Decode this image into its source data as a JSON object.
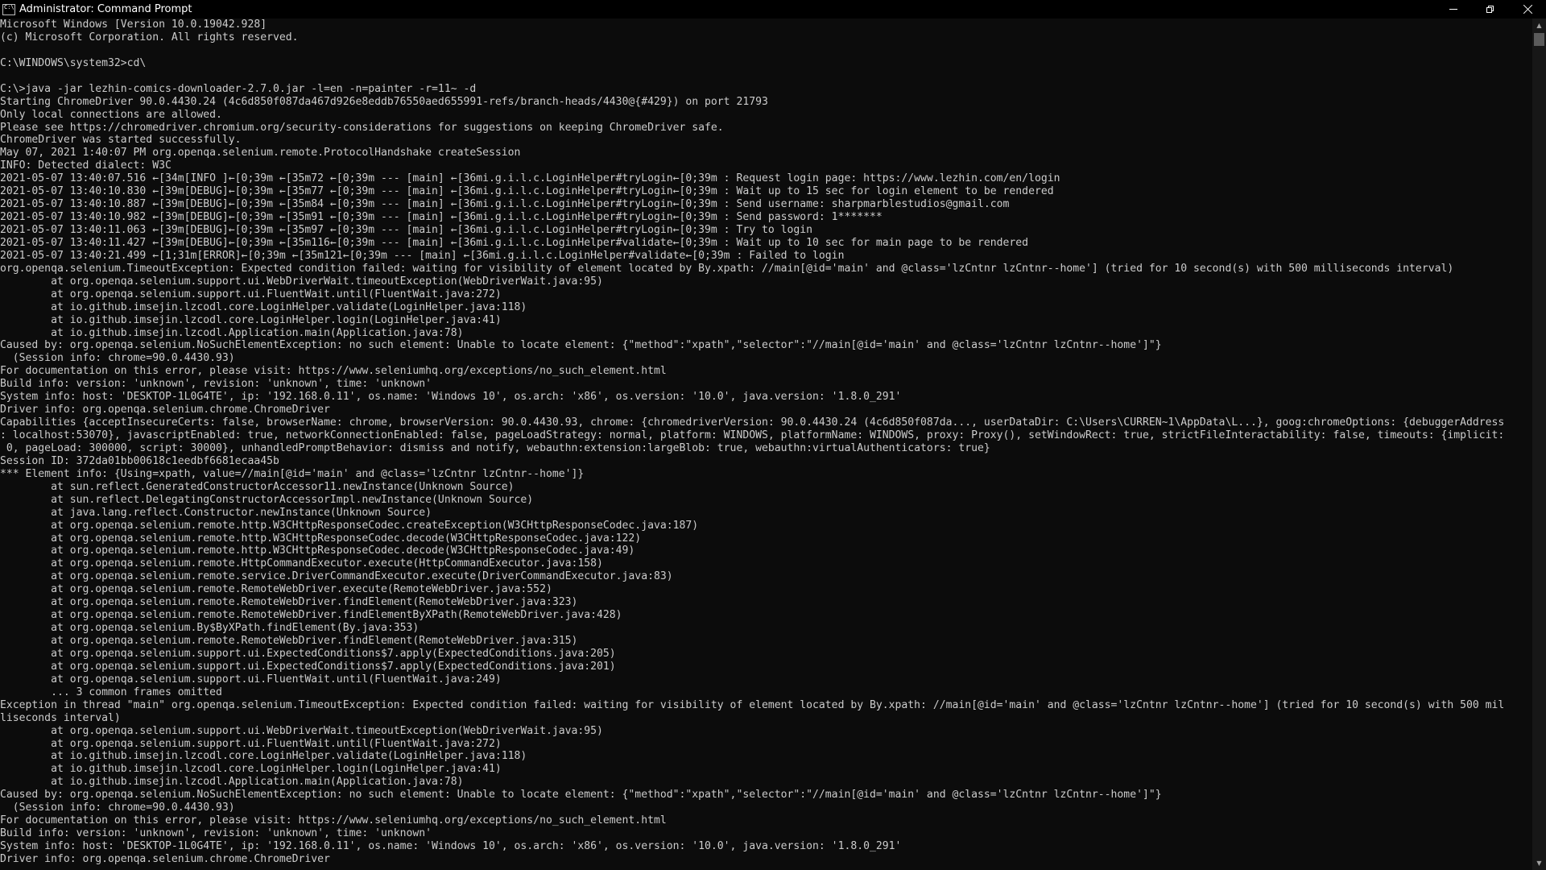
{
  "window": {
    "title": "Administrator: Command Prompt",
    "icons": {
      "app": "cmd-icon",
      "minimize": "minimize-icon",
      "restore": "restore-icon",
      "close": "close-icon"
    }
  },
  "console": {
    "lines": [
      "Microsoft Windows [Version 10.0.19042.928]",
      "(c) Microsoft Corporation. All rights reserved.",
      "",
      "C:\\WINDOWS\\system32>cd\\",
      "",
      "C:\\>java -jar lezhin-comics-downloader-2.7.0.jar -l=en -n=painter -r=11~ -d",
      "Starting ChromeDriver 90.0.4430.24 (4c6d850f087da467d926e8eddb76550aed655991-refs/branch-heads/4430@{#429}) on port 21793",
      "Only local connections are allowed.",
      "Please see https://chromedriver.chromium.org/security-considerations for suggestions on keeping ChromeDriver safe.",
      "ChromeDriver was started successfully.",
      "May 07, 2021 1:40:07 PM org.openqa.selenium.remote.ProtocolHandshake createSession",
      "INFO: Detected dialect: W3C",
      "2021-05-07 13:40:07.516 ←[34m[INFO ]←[0;39m ←[35m72 ←[0;39m --- [main] ←[36mi.g.i.l.c.LoginHelper#tryLogin←[0;39m : Request login page: https://www.lezhin.com/en/login",
      "2021-05-07 13:40:10.830 ←[39m[DEBUG]←[0;39m ←[35m77 ←[0;39m --- [main] ←[36mi.g.i.l.c.LoginHelper#tryLogin←[0;39m : Wait up to 15 sec for login element to be rendered",
      "2021-05-07 13:40:10.887 ←[39m[DEBUG]←[0;39m ←[35m84 ←[0;39m --- [main] ←[36mi.g.i.l.c.LoginHelper#tryLogin←[0;39m : Send username: sharpmarblestudios@gmail.com",
      "2021-05-07 13:40:10.982 ←[39m[DEBUG]←[0;39m ←[35m91 ←[0;39m --- [main] ←[36mi.g.i.l.c.LoginHelper#tryLogin←[0;39m : Send password: 1*******",
      "2021-05-07 13:40:11.063 ←[39m[DEBUG]←[0;39m ←[35m97 ←[0;39m --- [main] ←[36mi.g.i.l.c.LoginHelper#tryLogin←[0;39m : Try to login",
      "2021-05-07 13:40:11.427 ←[39m[DEBUG]←[0;39m ←[35m116←[0;39m --- [main] ←[36mi.g.i.l.c.LoginHelper#validate←[0;39m : Wait up to 10 sec for main page to be rendered",
      "2021-05-07 13:40:21.499 ←[1;31m[ERROR]←[0;39m ←[35m121←[0;39m --- [main] ←[36mi.g.i.l.c.LoginHelper#validate←[0;39m : Failed to login",
      "org.openqa.selenium.TimeoutException: Expected condition failed: waiting for visibility of element located by By.xpath: //main[@id='main' and @class='lzCntnr lzCntnr--home'] (tried for 10 second(s) with 500 milliseconds interval)",
      "        at org.openqa.selenium.support.ui.WebDriverWait.timeoutException(WebDriverWait.java:95)",
      "        at org.openqa.selenium.support.ui.FluentWait.until(FluentWait.java:272)",
      "        at io.github.imsejin.lzcodl.core.LoginHelper.validate(LoginHelper.java:118)",
      "        at io.github.imsejin.lzcodl.core.LoginHelper.login(LoginHelper.java:41)",
      "        at io.github.imsejin.lzcodl.Application.main(Application.java:78)",
      "Caused by: org.openqa.selenium.NoSuchElementException: no such element: Unable to locate element: {\"method\":\"xpath\",\"selector\":\"//main[@id='main' and @class='lzCntnr lzCntnr--home']\"}",
      "  (Session info: chrome=90.0.4430.93)",
      "For documentation on this error, please visit: https://www.seleniumhq.org/exceptions/no_such_element.html",
      "Build info: version: 'unknown', revision: 'unknown', time: 'unknown'",
      "System info: host: 'DESKTOP-1L0G4TE', ip: '192.168.0.11', os.name: 'Windows 10', os.arch: 'x86', os.version: '10.0', java.version: '1.8.0_291'",
      "Driver info: org.openqa.selenium.chrome.ChromeDriver",
      "Capabilities {acceptInsecureCerts: false, browserName: chrome, browserVersion: 90.0.4430.93, chrome: {chromedriverVersion: 90.0.4430.24 (4c6d850f087da..., userDataDir: C:\\Users\\CURREN~1\\AppData\\L...}, goog:chromeOptions: {debuggerAddress",
      ": localhost:53070}, javascriptEnabled: true, networkConnectionEnabled: false, pageLoadStrategy: normal, platform: WINDOWS, platformName: WINDOWS, proxy: Proxy(), setWindowRect: true, strictFileInteractability: false, timeouts: {implicit:",
      " 0, pageLoad: 300000, script: 30000}, unhandledPromptBehavior: dismiss and notify, webauthn:extension:largeBlob: true, webauthn:virtualAuthenticators: true}",
      "Session ID: 372da01bb00618c1eedbf6681ecaa45b",
      "*** Element info: {Using=xpath, value=//main[@id='main' and @class='lzCntnr lzCntnr--home']}",
      "        at sun.reflect.GeneratedConstructorAccessor11.newInstance(Unknown Source)",
      "        at sun.reflect.DelegatingConstructorAccessorImpl.newInstance(Unknown Source)",
      "        at java.lang.reflect.Constructor.newInstance(Unknown Source)",
      "        at org.openqa.selenium.remote.http.W3CHttpResponseCodec.createException(W3CHttpResponseCodec.java:187)",
      "        at org.openqa.selenium.remote.http.W3CHttpResponseCodec.decode(W3CHttpResponseCodec.java:122)",
      "        at org.openqa.selenium.remote.http.W3CHttpResponseCodec.decode(W3CHttpResponseCodec.java:49)",
      "        at org.openqa.selenium.remote.HttpCommandExecutor.execute(HttpCommandExecutor.java:158)",
      "        at org.openqa.selenium.remote.service.DriverCommandExecutor.execute(DriverCommandExecutor.java:83)",
      "        at org.openqa.selenium.remote.RemoteWebDriver.execute(RemoteWebDriver.java:552)",
      "        at org.openqa.selenium.remote.RemoteWebDriver.findElement(RemoteWebDriver.java:323)",
      "        at org.openqa.selenium.remote.RemoteWebDriver.findElementByXPath(RemoteWebDriver.java:428)",
      "        at org.openqa.selenium.By$ByXPath.findElement(By.java:353)",
      "        at org.openqa.selenium.remote.RemoteWebDriver.findElement(RemoteWebDriver.java:315)",
      "        at org.openqa.selenium.support.ui.ExpectedConditions$7.apply(ExpectedConditions.java:205)",
      "        at org.openqa.selenium.support.ui.ExpectedConditions$7.apply(ExpectedConditions.java:201)",
      "        at org.openqa.selenium.support.ui.FluentWait.until(FluentWait.java:249)",
      "        ... 3 common frames omitted",
      "Exception in thread \"main\" org.openqa.selenium.TimeoutException: Expected condition failed: waiting for visibility of element located by By.xpath: //main[@id='main' and @class='lzCntnr lzCntnr--home'] (tried for 10 second(s) with 500 mil",
      "liseconds interval)",
      "        at org.openqa.selenium.support.ui.WebDriverWait.timeoutException(WebDriverWait.java:95)",
      "        at org.openqa.selenium.support.ui.FluentWait.until(FluentWait.java:272)",
      "        at io.github.imsejin.lzcodl.core.LoginHelper.validate(LoginHelper.java:118)",
      "        at io.github.imsejin.lzcodl.core.LoginHelper.login(LoginHelper.java:41)",
      "        at io.github.imsejin.lzcodl.Application.main(Application.java:78)",
      "Caused by: org.openqa.selenium.NoSuchElementException: no such element: Unable to locate element: {\"method\":\"xpath\",\"selector\":\"//main[@id='main' and @class='lzCntnr lzCntnr--home']\"}",
      "  (Session info: chrome=90.0.4430.93)",
      "For documentation on this error, please visit: https://www.seleniumhq.org/exceptions/no_such_element.html",
      "Build info: version: 'unknown', revision: 'unknown', time: 'unknown'",
      "System info: host: 'DESKTOP-1L0G4TE', ip: '192.168.0.11', os.name: 'Windows 10', os.arch: 'x86', os.version: '10.0', java.version: '1.8.0_291'",
      "Driver info: org.openqa.selenium.chrome.ChromeDriver"
    ]
  },
  "scrollbar": {
    "up_arrow": "▲",
    "down_arrow": "▼",
    "up_icon": "scroll-up-arrow-icon",
    "down_icon": "scroll-down-arrow-icon"
  }
}
